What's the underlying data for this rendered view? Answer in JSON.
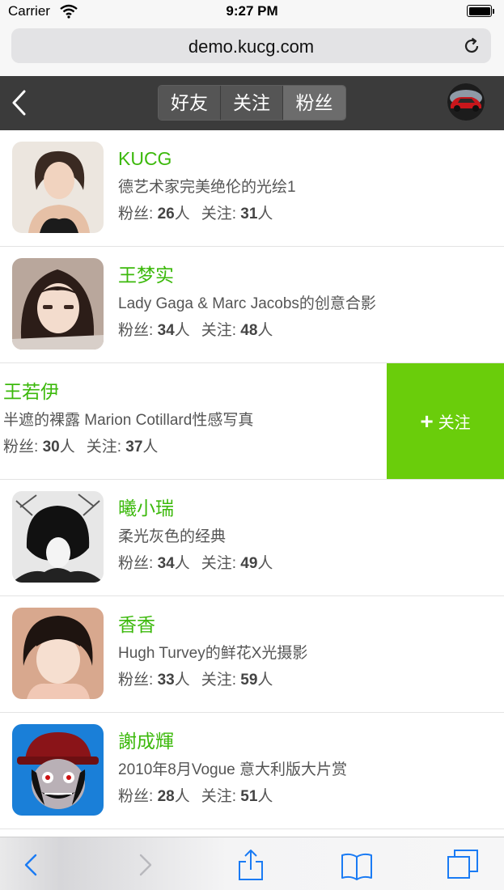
{
  "status_bar": {
    "carrier": "Carrier",
    "time": "9:27 PM"
  },
  "browser": {
    "url": "demo.kucg.com"
  },
  "header": {
    "tabs": [
      {
        "label": "好友",
        "active": false
      },
      {
        "label": "关注",
        "active": false
      },
      {
        "label": "粉丝",
        "active": true
      }
    ]
  },
  "labels": {
    "fans": "粉丝:",
    "following": "关注:",
    "unit": "人",
    "follow_button": "关注"
  },
  "users": [
    {
      "name": "KUCG",
      "desc": "德艺术家完美绝伦的光绘1",
      "fans": "26",
      "following": "31"
    },
    {
      "name": "王梦实",
      "desc": "Lady Gaga & Marc Jacobs的创意合影",
      "fans": "34",
      "following": "48"
    },
    {
      "name": "王若伊",
      "desc": "半遮的裸露 Marion Cotillard性感写真",
      "fans": "30",
      "following": "37"
    },
    {
      "name": "曦小瑞",
      "desc": "柔光灰色的经典",
      "fans": "34",
      "following": "49"
    },
    {
      "name": "香香",
      "desc": "Hugh Turvey的鲜花X光摄影",
      "fans": "33",
      "following": "59"
    },
    {
      "name": "謝成輝",
      "desc": "2010年8月Vogue 意大利版大片赏",
      "fans": "28",
      "following": "51"
    }
  ],
  "colors": {
    "accent_green": "#3cb90c",
    "follow_button_bg": "#6acd0b",
    "header_bg": "#3b3b3b",
    "ios_blue": "#1a7bf4"
  }
}
